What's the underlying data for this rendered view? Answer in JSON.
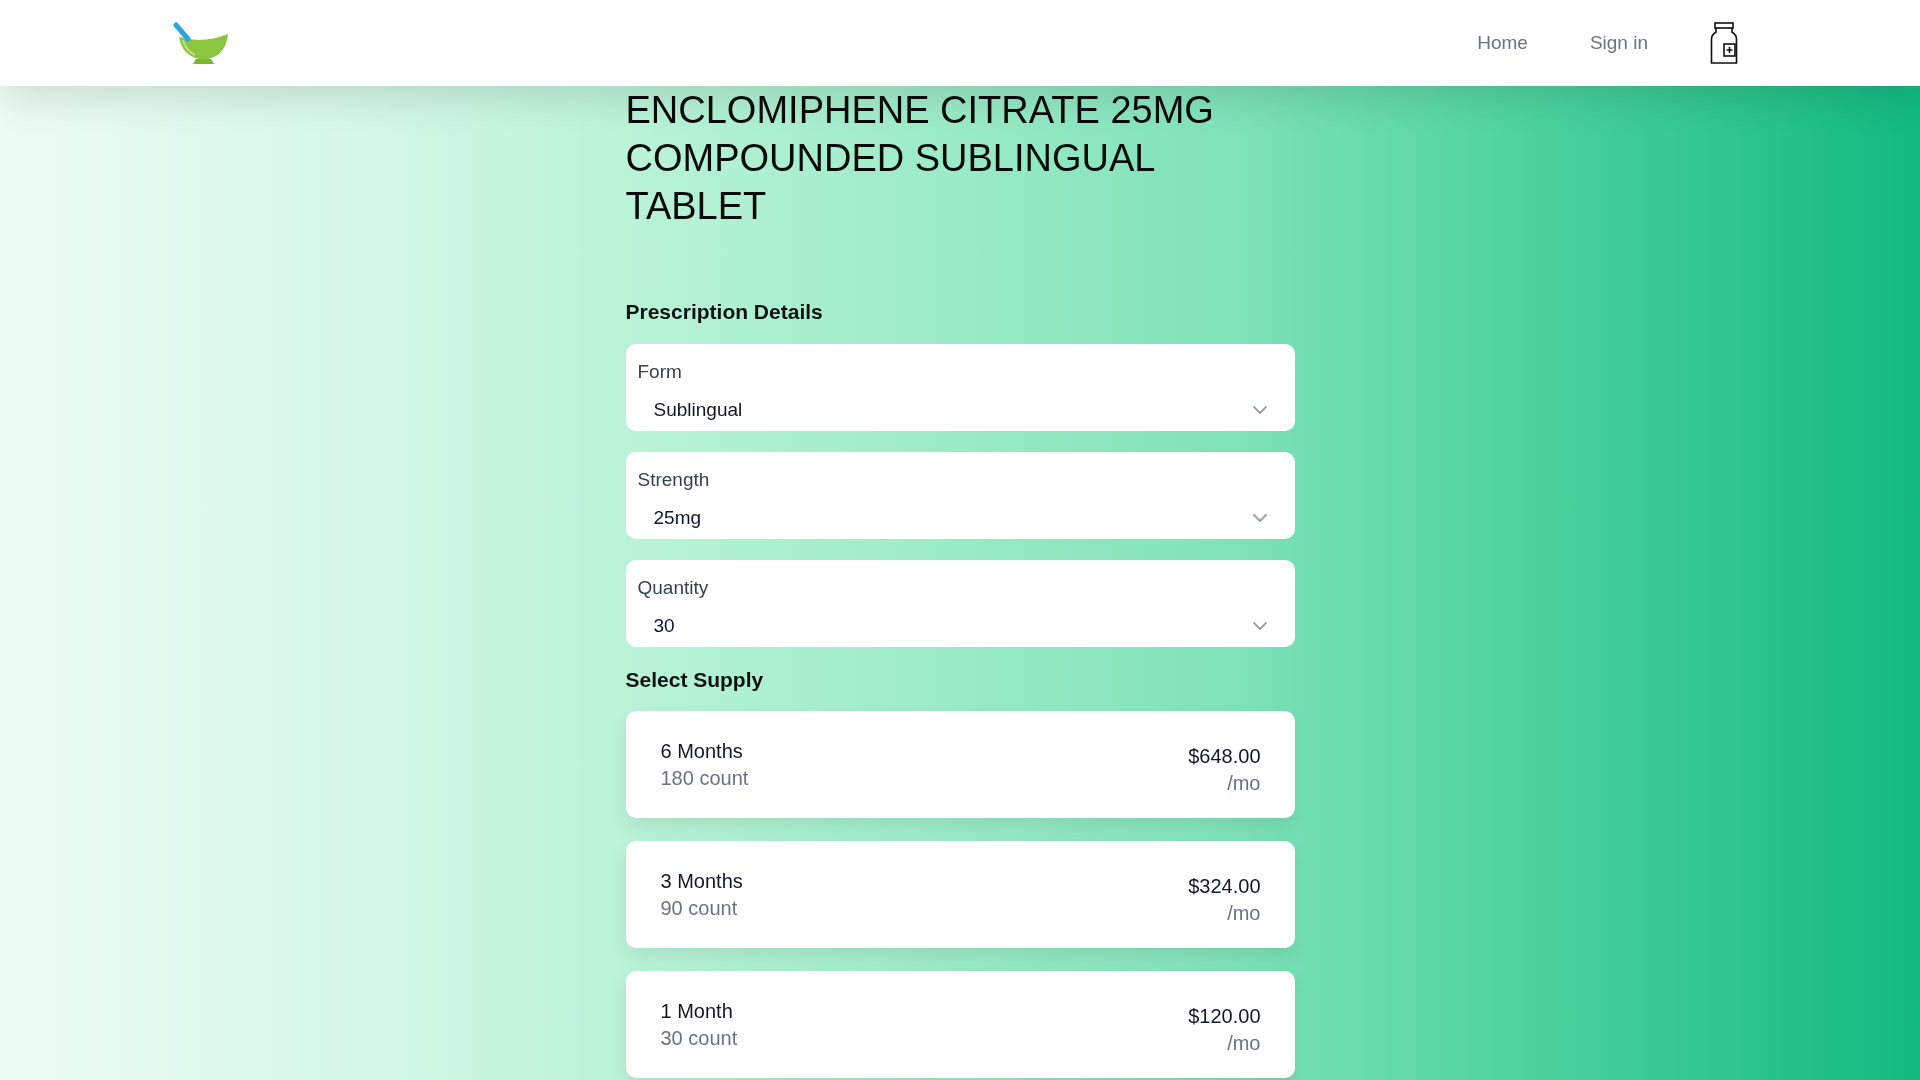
{
  "header": {
    "nav_links": [
      {
        "label": "Home"
      },
      {
        "label": "Sign in"
      }
    ]
  },
  "product": {
    "title": "ENCLOMIPHENE CITRATE 25MG COMPOUNDED SUBLINGUAL TABLET"
  },
  "prescription_details": {
    "heading": "Prescription Details",
    "fields": [
      {
        "label": "Form",
        "value": "Sublingual"
      },
      {
        "label": "Strength",
        "value": "25mg"
      },
      {
        "label": "Quantity",
        "value": "30"
      }
    ]
  },
  "supply": {
    "heading": "Select Supply",
    "options": [
      {
        "duration": "6 Months",
        "count": "180 count",
        "price": "$648.00",
        "unit": "/mo",
        "selected": false
      },
      {
        "duration": "3 Months",
        "count": "90 count",
        "price": "$324.00",
        "unit": "/mo",
        "selected": false
      },
      {
        "duration": "1 Month",
        "count": "30 count",
        "price": "$120.00",
        "unit": "/mo",
        "selected": false
      }
    ]
  }
}
